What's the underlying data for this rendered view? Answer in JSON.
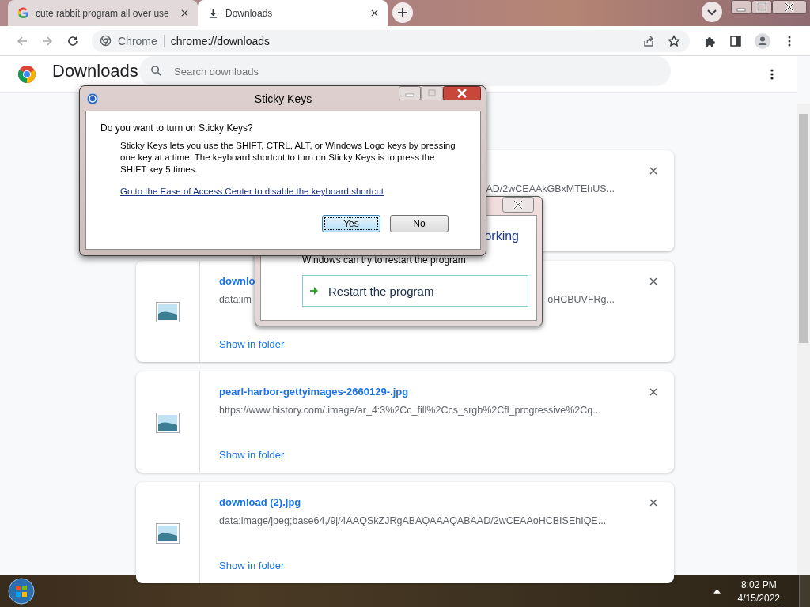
{
  "browser": {
    "tabs": [
      {
        "title": "cute rabbit program all over use",
        "selected": false
      },
      {
        "title": "Downloads",
        "selected": true
      }
    ],
    "address": {
      "site_label": "Chrome",
      "url": "chrome://downloads"
    }
  },
  "page": {
    "title": "Downloads",
    "search": {
      "placeholder": "Search downloads"
    },
    "downloads": [
      {
        "url_tail": "AD/2wCEAAkGBxMTEhUS..."
      },
      {
        "name": "downlo",
        "url": "data:im",
        "url_tail": "oHCBUVFRg...",
        "action": "Show in folder"
      },
      {
        "name": "pearl-harbor-gettyimages-2660129-.jpg",
        "url": "https://www.history.com/.image/ar_4:3%2Cc_fill%2Ccs_srgb%2Cfl_progressive%2Cq...",
        "action": "Show in folder"
      },
      {
        "name": "download (2).jpg",
        "url": "data:image/jpeg;base64,/9j/4AAQSkZJRgABAQAAAQABAAD/2wCEAAoHCBISEhIQE...",
        "action": "Show in folder"
      }
    ]
  },
  "sticky_keys_dialog": {
    "title": "Sticky Keys",
    "question": "Do you want to turn on Sticky Keys?",
    "description": "Sticky Keys lets you use the SHIFT, CTRL, ALT, or Windows Logo keys by pressing one key at a time. The keyboard shortcut to turn on Sticky Keys is to press the SHIFT key 5 times.",
    "link": "Go to the Ease of Access Center to disable the keyboard shortcut",
    "buttons": [
      {
        "label": "Yes",
        "selected": true
      },
      {
        "label": "No",
        "selected": false
      }
    ]
  },
  "error_dialog": {
    "heading": "orking",
    "message": "Windows can try to restart the program.",
    "action": "Restart the program"
  },
  "taskbar": {
    "time": "8:02 PM",
    "date": "4/15/2022"
  }
}
